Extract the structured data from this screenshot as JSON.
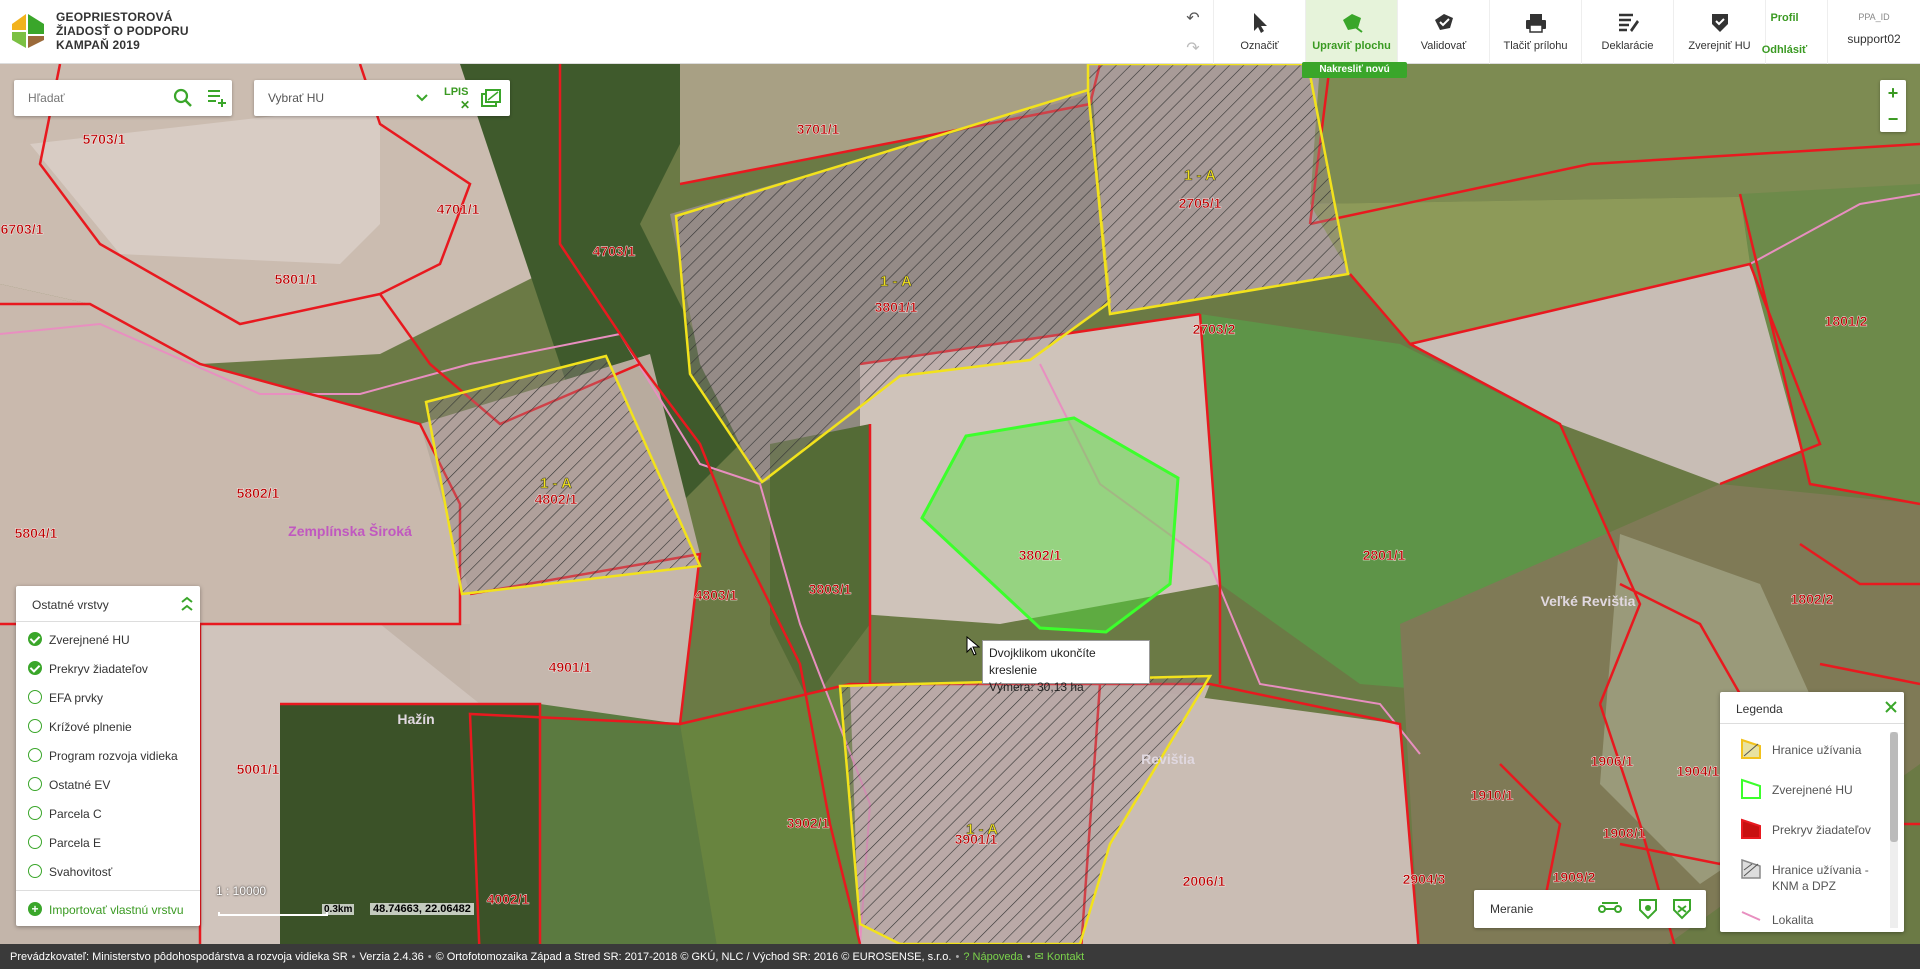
{
  "app": {
    "title_line1": "GEOPRIESTOROVÁ",
    "title_line2": "ŽIADOSŤ O PODPORU",
    "title_line3": "KAMPAŇ 2019"
  },
  "toolbar": {
    "items": [
      {
        "label": "Označiť"
      },
      {
        "label": "Upraviť plochu"
      },
      {
        "label": "Validovať"
      },
      {
        "label": "Tlačiť prílohu"
      },
      {
        "label": "Deklarácie"
      },
      {
        "label": "Zverejniť HU"
      }
    ],
    "nakreslit_label": "Nakresliť novú",
    "profile_label": "Profil",
    "logout_label": "Odhlásiť",
    "ppa_id_label": "PPA_ID",
    "ppa_id_value": "support02"
  },
  "search": {
    "placeholder": "Hľadať",
    "hu_select": "Vybrať HU",
    "lpis_label": "LPIS"
  },
  "zoom": {
    "in": "+",
    "out": "−"
  },
  "layers_panel": {
    "title": "Ostatné vrstvy",
    "items": [
      {
        "label": "Zverejnené HU",
        "checked": true
      },
      {
        "label": "Prekryv žiadateľov",
        "checked": true
      },
      {
        "label": "EFA prvky",
        "checked": false
      },
      {
        "label": "Krížové plnenie",
        "checked": false
      },
      {
        "label": "Program rozvoja vidieka",
        "checked": false
      },
      {
        "label": "Ostatné EV",
        "checked": false
      },
      {
        "label": "Parcela C",
        "checked": false
      },
      {
        "label": "Parcela E",
        "checked": false
      },
      {
        "label": "Svahovitosť",
        "checked": false
      }
    ],
    "import_label": "Importovať vlastnú vrstvu"
  },
  "scale": {
    "ratio": "1 : 10000",
    "bar": "0.3km",
    "coords": "48.74663, 22.06482"
  },
  "measure": {
    "label": "Meranie"
  },
  "legend": {
    "title": "Legenda",
    "items": [
      {
        "label": "Hranice užívania"
      },
      {
        "label": "Zverejnené HU"
      },
      {
        "label": "Prekryv žiadateľov"
      },
      {
        "label": "Hranice užívania -"
      },
      {
        "label": "KNM a DPZ"
      },
      {
        "label": "Lokalita"
      }
    ]
  },
  "tooltip": {
    "line1": "Dvojklikom ukončíte kreslenie",
    "line2": "Výmera: 30,13 ha"
  },
  "map": {
    "parcels": [
      "5703/1",
      "6703/1",
      "4701/1",
      "4703/1",
      "3701/1",
      "2705/1",
      "1801/2",
      "5801/1",
      "3801/1",
      "2703/2",
      "5802/1",
      "4802/1",
      "5804/1",
      "3802/1",
      "2801/1",
      "1802/2",
      "4803/1",
      "3803/1",
      "4901/1",
      "5001/1",
      "3902/1",
      "3901/1",
      "2006/1",
      "1906/1",
      "1904/1",
      "1910/1",
      "1908/1",
      "2904/3",
      "1909/2",
      "4002/1"
    ],
    "use_labels": [
      "1 - A",
      "1 - A",
      "1 - A",
      "1 - A"
    ],
    "places": [
      "Zemplínska Široká",
      "Hažín",
      "Veľké Revištia",
      "Revištia"
    ]
  },
  "footer": {
    "operator": "Prevádzkovateľ: Ministerstvo pôdohospodárstva a rozvoja vidieka SR",
    "version": "Verzia 2.4.36",
    "copyright": "© Ortofotomozaika Západ a Stred SR: 2017-2018 © GKÚ, NLC / Východ SR: 2016 © EUROSENSE, s.r.o.",
    "help": "Nápoveda",
    "contact": "Kontakt"
  },
  "colors": {
    "accent": "#3aa62a",
    "parcel": "#e8191f",
    "hu": "#f2e21c",
    "drawn": "#3cff2c"
  }
}
